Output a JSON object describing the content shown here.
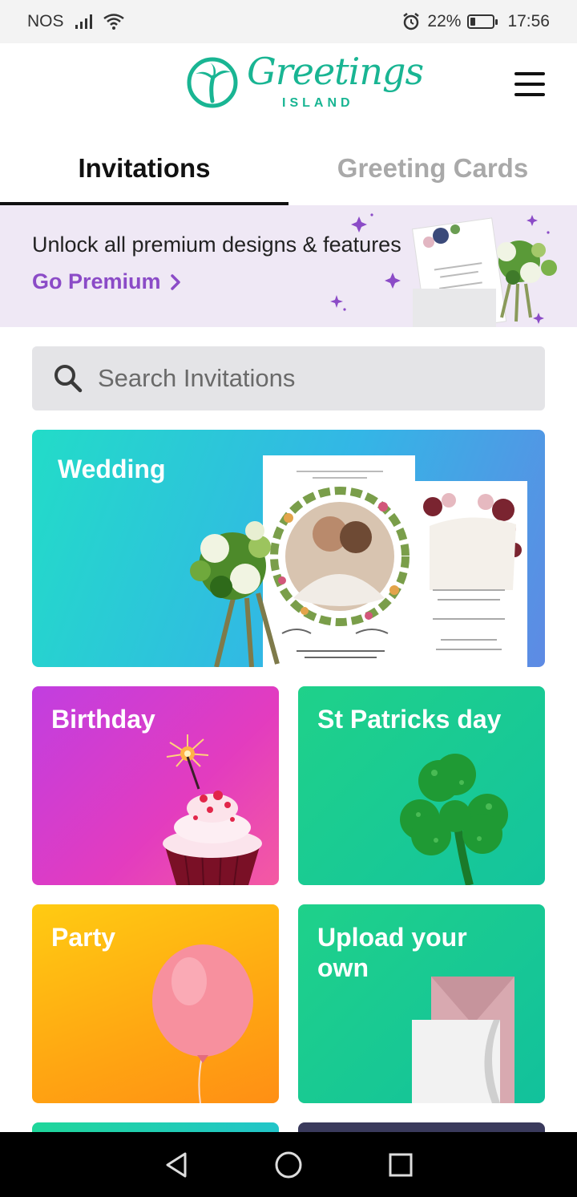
{
  "status_bar": {
    "carrier": "NOS",
    "battery": "22%",
    "time": "17:56"
  },
  "header": {
    "logo_script": "Greetings",
    "logo_island": "ISLAND",
    "menu_icon": "hamburger-menu-icon"
  },
  "tabs": [
    {
      "label": "Invitations",
      "active": true
    },
    {
      "label": "Greeting Cards",
      "active": false
    }
  ],
  "premium": {
    "text": "Unlock all premium designs & features",
    "link": "Go Premium"
  },
  "search": {
    "placeholder": "Search Invitations",
    "icon": "search-icon"
  },
  "categories": [
    {
      "label": "Wedding"
    },
    {
      "label": "Birthday"
    },
    {
      "label": "St Patricks day"
    },
    {
      "label": "Party"
    },
    {
      "label": "Upload your own"
    }
  ],
  "colors": {
    "brand": "#19b593",
    "premium_accent": "#8b4bc7",
    "tab_active": "#111111",
    "tab_inactive": "#a9a9a9"
  },
  "nav": {
    "back": "back-icon",
    "home": "home-icon",
    "recents": "recents-icon"
  }
}
